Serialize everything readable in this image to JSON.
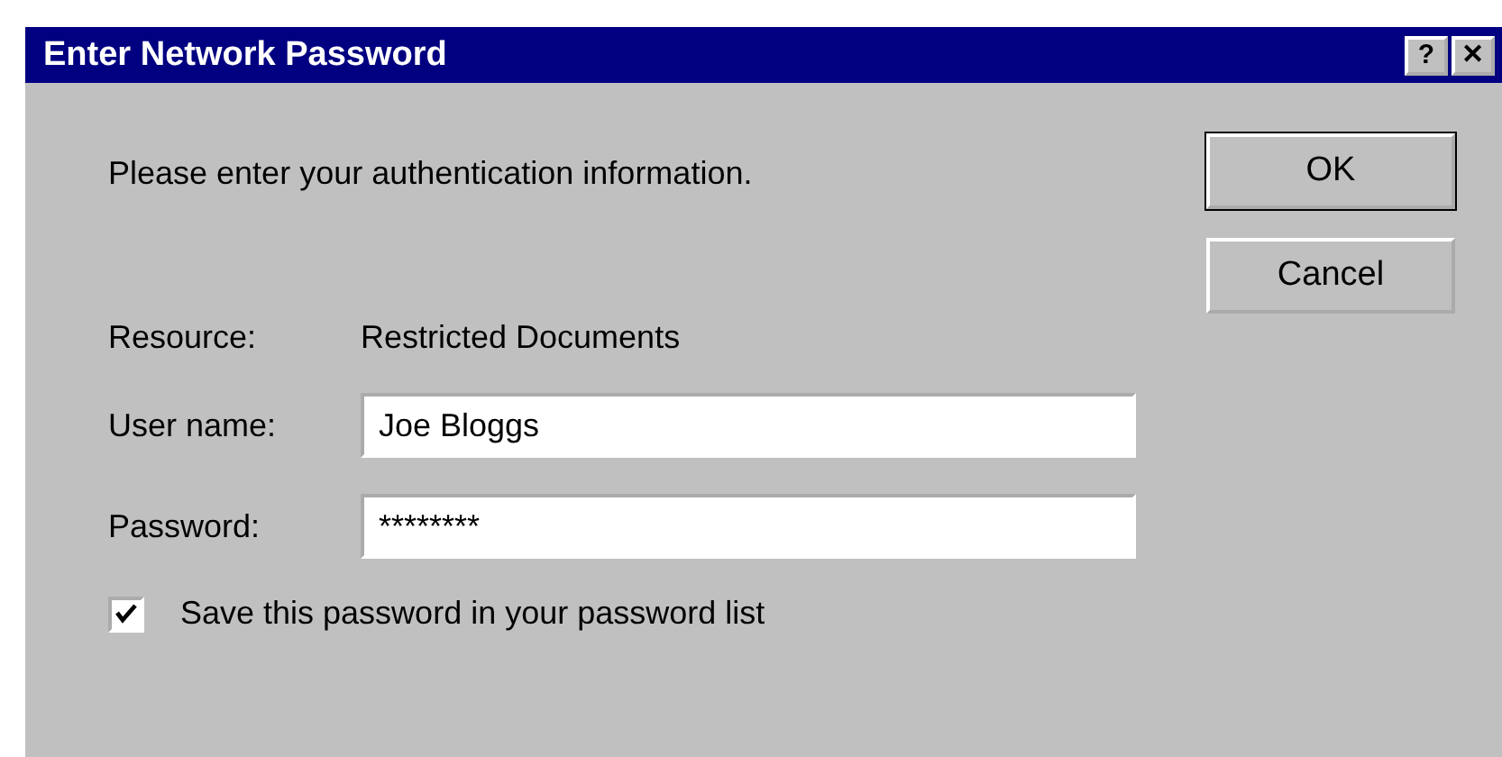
{
  "window": {
    "title": "Enter Network Password",
    "title_buttons": [
      "?",
      "✕"
    ]
  },
  "message": "Please enter your authentication information.",
  "resource": {
    "label": "Resource:",
    "value": "Restricted Documents"
  },
  "fields": [
    {
      "label": "User name:",
      "value": "Joe Bloggs"
    },
    {
      "label": "Password:",
      "value": "********"
    }
  ],
  "save_password": {
    "label": "Save this password in your password list",
    "checked": true
  },
  "buttons": [
    "OK",
    "Cancel"
  ]
}
